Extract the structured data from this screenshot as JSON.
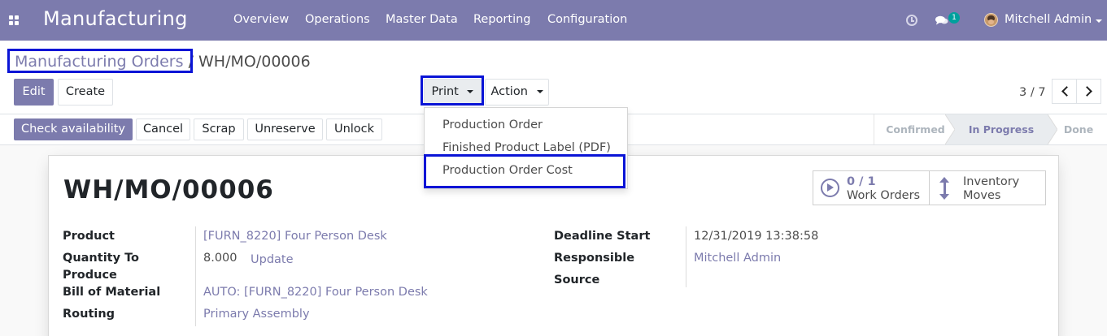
{
  "navbar": {
    "app_title": "Manufacturing",
    "menu": [
      "Overview",
      "Operations",
      "Master Data",
      "Reporting",
      "Configuration"
    ],
    "chat_badge": "1",
    "user_name": "Mitchell Admin",
    "icons": [
      "apps-icon",
      "clock-icon",
      "chat-icon",
      "avatar"
    ]
  },
  "breadcrumb": {
    "parent": "Manufacturing Orders",
    "current": "/ WH/MO/00006"
  },
  "toolbar": {
    "edit": "Edit",
    "create": "Create",
    "print": "Print",
    "action": "Action",
    "pager": "3 / 7"
  },
  "print_menu": {
    "items": [
      "Production Order",
      "Finished Product Label (PDF)",
      "Production Order Cost"
    ],
    "highlighted": "Production Order Cost"
  },
  "statusbar": {
    "buttons": [
      "Check availability",
      "Cancel",
      "Scrap",
      "Unreserve",
      "Unlock"
    ],
    "stages": [
      "Confirmed",
      "In Progress",
      "Done"
    ],
    "active_stage": "In Progress"
  },
  "form": {
    "title": "WH/MO/00006",
    "smart_buttons": {
      "work_orders_value": "0 / 1",
      "work_orders_label": "Work Orders",
      "inventory_line1": "Inventory",
      "inventory_line2": "Moves"
    },
    "left": {
      "product_label": "Product",
      "product_value": "[FURN_8220] Four Person Desk",
      "qty_label_line1": "Quantity To",
      "qty_label_line2": "Produce",
      "qty_value": "8.000",
      "qty_update": "Update",
      "bom_label": "Bill of Material",
      "bom_value": "AUTO: [FURN_8220] Four Person Desk",
      "routing_label": "Routing",
      "routing_value": "Primary Assembly"
    },
    "right": {
      "deadline_label": "Deadline Start",
      "deadline_value": "12/31/2019 13:38:58",
      "responsible_label": "Responsible",
      "responsible_value": "Mitchell Admin",
      "source_label": "Source",
      "source_value": ""
    }
  },
  "colors": {
    "brand": "#7c7bad",
    "highlight": "#0a14d6",
    "active_stage_bg": "#e9ecef"
  }
}
